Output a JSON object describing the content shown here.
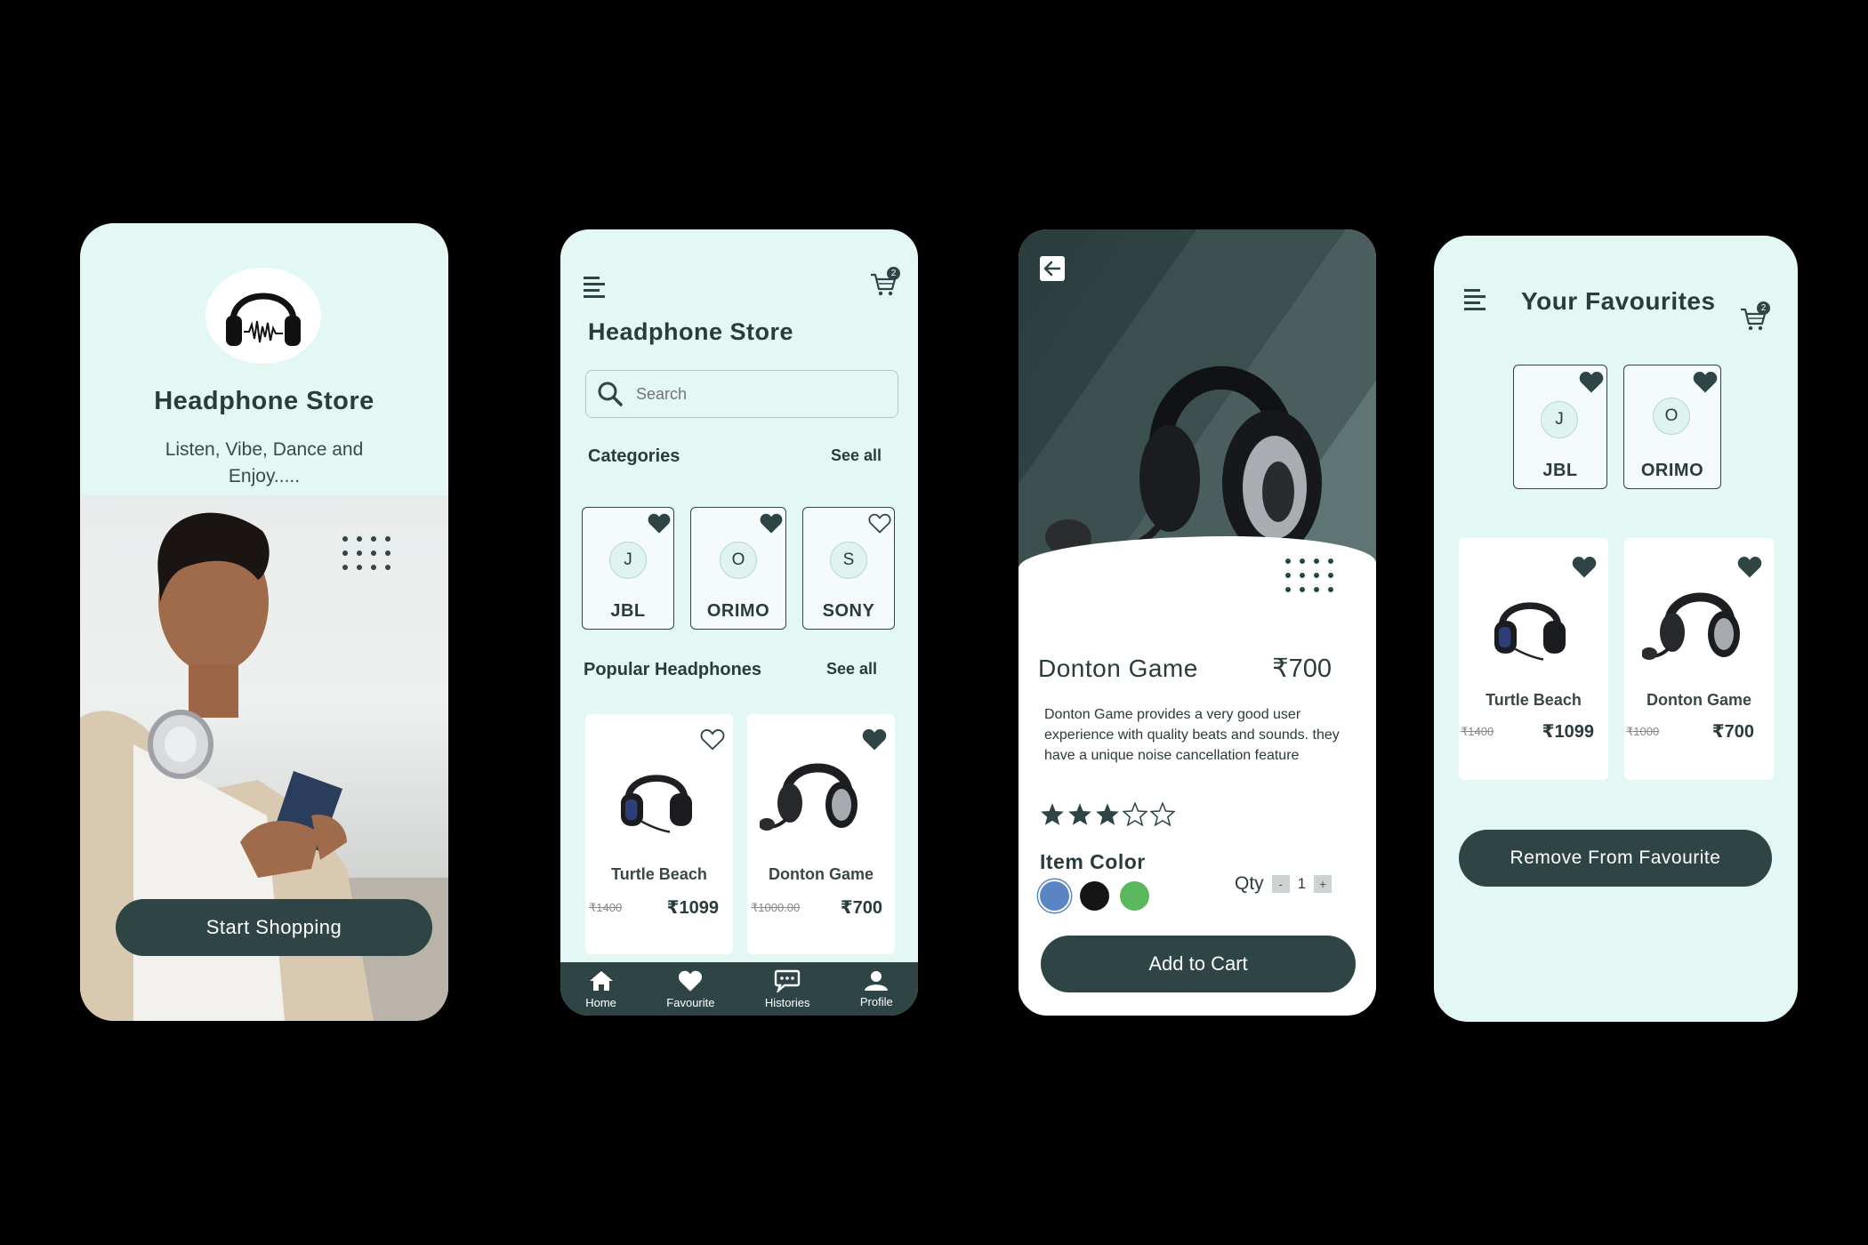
{
  "screen1": {
    "title": "Headphone Store",
    "tagline": "Listen, Vibe, Dance and Enjoy.....",
    "cta": "Start Shopping"
  },
  "screen2": {
    "title": "Headphone Store",
    "cart_count": "2",
    "search_placeholder": "Search",
    "categories_heading": "Categories",
    "categories_see_all": "See all",
    "categories": [
      {
        "letter": "J",
        "label": "JBL",
        "favourite": true
      },
      {
        "letter": "O",
        "label": "ORIMO",
        "favourite": true
      },
      {
        "letter": "S",
        "label": "SONY",
        "favourite": false
      }
    ],
    "popular_heading": "Popular Headphones",
    "popular_see_all": "See all",
    "products": [
      {
        "name": "Turtle Beach",
        "old_price": "₹1400",
        "price": "₹1099",
        "favourite": false
      },
      {
        "name": "Donton Game",
        "old_price": "₹1000.00",
        "price": "₹700",
        "favourite": true
      }
    ],
    "nav": [
      {
        "label": "Home",
        "icon": "home-icon"
      },
      {
        "label": "Favourite",
        "icon": "heart-icon"
      },
      {
        "label": "Histories",
        "icon": "chat-icon"
      },
      {
        "label": "Profile",
        "icon": "user-icon"
      }
    ]
  },
  "screen3": {
    "product_name": "Donton Game",
    "price": "₹700",
    "description": "Donton Game provides a very good user experience with quality beats and sounds. they have a unique noise cancellation feature",
    "rating": 3,
    "rating_max": 5,
    "item_color_label": "Item Color",
    "colors": [
      "#5b84c4",
      "#151515",
      "#5cb85c"
    ],
    "qty_label": "Qty",
    "qty_minus": "-",
    "qty_value": "1",
    "qty_plus": "+",
    "cta": "Add to Cart"
  },
  "screen4": {
    "title": "Your Favourites",
    "cart_count": "2",
    "brands": [
      {
        "letter": "J",
        "label": "JBL"
      },
      {
        "letter": "O",
        "label": "ORIMO"
      }
    ],
    "products": [
      {
        "name": "Turtle Beach",
        "old_price": "₹1400",
        "price": "₹1099"
      },
      {
        "name": "Donton Game",
        "old_price": "₹1000",
        "price": "₹700"
      }
    ],
    "cta": "Remove From Favourite"
  },
  "colors": {
    "accent_dark": "#2f4545",
    "background_mint": "#e3f7f4",
    "canvas": "#000000"
  }
}
